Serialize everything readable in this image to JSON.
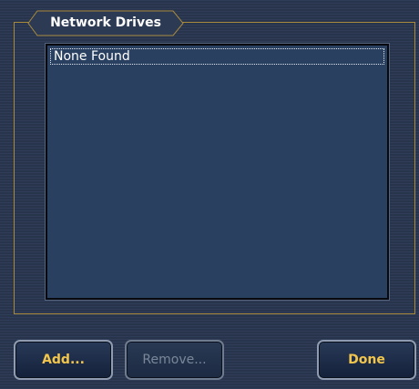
{
  "group": {
    "title": "Network Drives"
  },
  "drives_list": {
    "items": [
      "None Found"
    ]
  },
  "buttons": {
    "add_label": "Add...",
    "remove_label": "Remove...",
    "done_label": "Done"
  },
  "colors": {
    "accent_text": "#f2c64c",
    "frame_border": "#a88a3c",
    "disabled_text": "#7b8799"
  }
}
